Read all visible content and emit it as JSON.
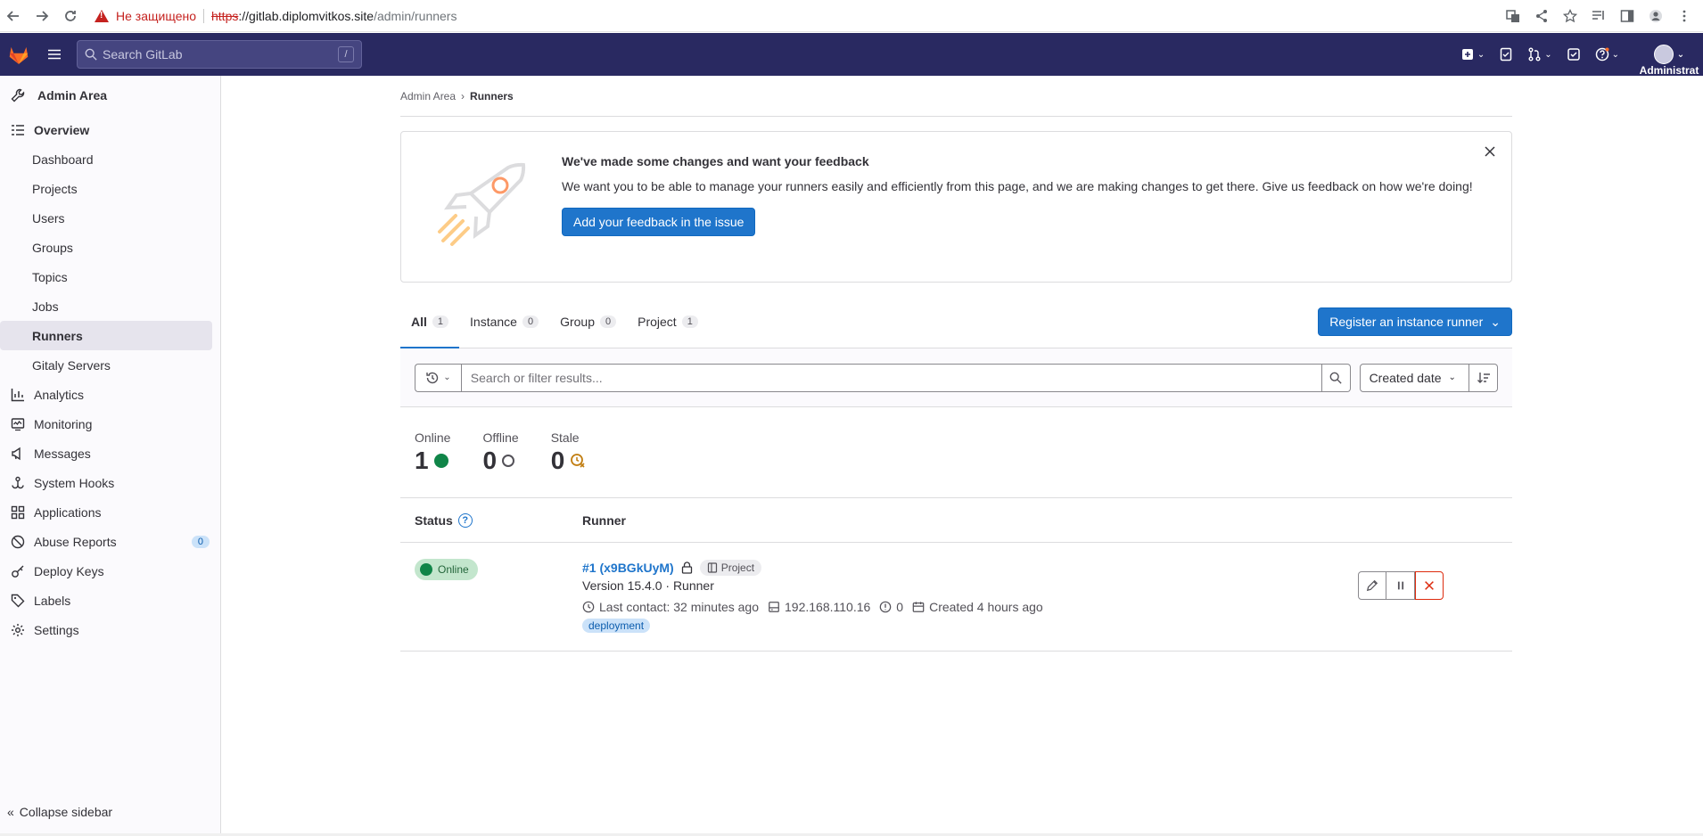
{
  "browser": {
    "insecure_label": "Не защищено",
    "url_scheme": "https",
    "url_host": "://gitlab.diplomvitkos.site",
    "url_path": "/admin/runners"
  },
  "topbar": {
    "search_placeholder": "Search GitLab",
    "search_shortcut": "/",
    "user_label": "Administrat"
  },
  "sidebar": {
    "header": "Admin Area",
    "overview": "Overview",
    "sub_items": [
      "Dashboard",
      "Projects",
      "Users",
      "Groups",
      "Topics",
      "Jobs",
      "Runners",
      "Gitaly Servers"
    ],
    "items": [
      "Analytics",
      "Monitoring",
      "Messages",
      "System Hooks",
      "Applications",
      "Abuse Reports",
      "Deploy Keys",
      "Labels",
      "Settings"
    ],
    "abuse_count": "0",
    "collapse": "Collapse sidebar"
  },
  "breadcrumb": {
    "root": "Admin Area",
    "current": "Runners"
  },
  "banner": {
    "title": "We've made some changes and want your feedback",
    "text": "We want you to be able to manage your runners easily and efficiently from this page, and we are making changes to get there. Give us feedback on how we're doing!",
    "button": "Add your feedback in the issue"
  },
  "tabs": [
    {
      "label": "All",
      "count": "1"
    },
    {
      "label": "Instance",
      "count": "0"
    },
    {
      "label": "Group",
      "count": "0"
    },
    {
      "label": "Project",
      "count": "1"
    }
  ],
  "register_button": "Register an instance runner",
  "filter": {
    "placeholder": "Search or filter results...",
    "sort": "Created date"
  },
  "stats": [
    {
      "label": "Online",
      "value": "1"
    },
    {
      "label": "Offline",
      "value": "0"
    },
    {
      "label": "Stale",
      "value": "0"
    }
  ],
  "table": {
    "col_status": "Status",
    "col_runner": "Runner",
    "rows": [
      {
        "status": "Online",
        "name": "#1 (x9BGkUyM)",
        "type": "Project",
        "version": "Version 15.4.0 · Runner",
        "last_contact": "Last contact: 32 minutes ago",
        "ip": "192.168.110.16",
        "jobs": "0",
        "created": "Created 4 hours ago",
        "tag": "deployment"
      }
    ]
  },
  "colors": {
    "topbar": "#292961",
    "primary": "#1f75cb",
    "online": "#108548",
    "danger": "#dd2b0e"
  }
}
